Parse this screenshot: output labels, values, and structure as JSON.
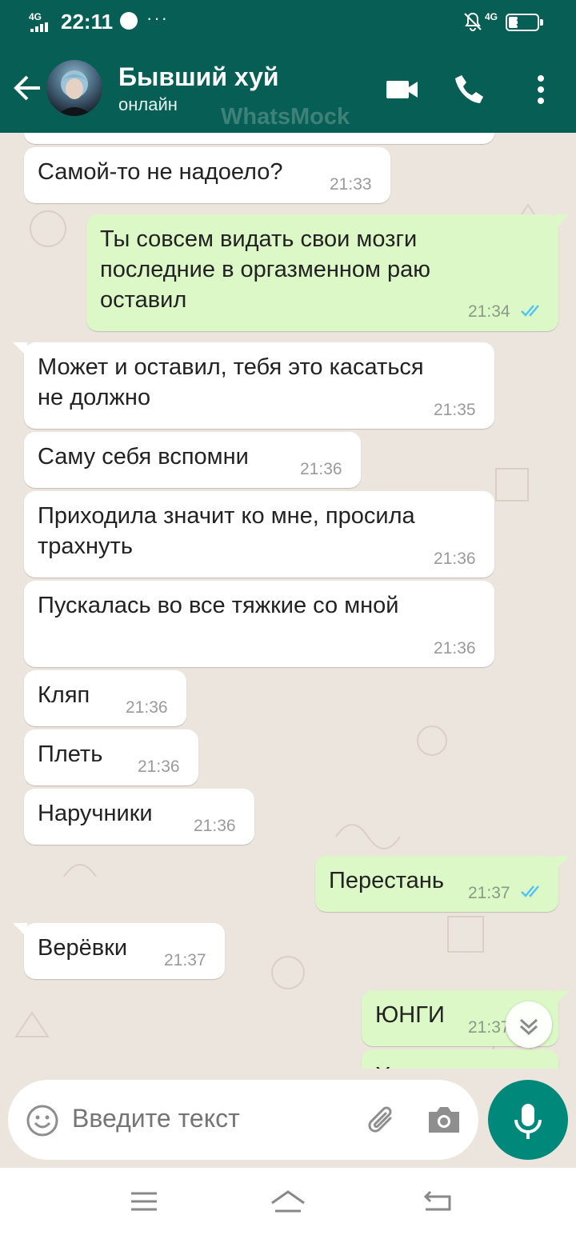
{
  "status_bar": {
    "network_left": "4G",
    "time": "22:11",
    "more": "···",
    "network_right": "4G",
    "battery_percent": 31,
    "battery_text": "31"
  },
  "header": {
    "contact_name": "Бывший хуй",
    "contact_status": "онлайн",
    "watermark": "WhatsMock",
    "icons": [
      "back-arrow-icon",
      "video-call-icon",
      "voice-call-icon",
      "more-vertical-icon"
    ]
  },
  "messages": [
    {
      "direction": "in",
      "text": "Самой-то не надоело?",
      "time": "21:33"
    },
    {
      "direction": "out",
      "text": "Ты совсем видать свои мозги\nпоследние в оргазменном раю\nоставил",
      "time": "21:34",
      "read": true
    },
    {
      "direction": "in",
      "text": "Может и оставил, тебя это касаться\nне должно",
      "time": "21:35"
    },
    {
      "direction": "in",
      "text": "Саму себя вспомни",
      "time": "21:36"
    },
    {
      "direction": "in",
      "text": "Приходила значит ко мне, просила\nтрахнуть",
      "time": "21:36"
    },
    {
      "direction": "in",
      "text": "Пускалась во все тяжкие со мной",
      "time": "21:36"
    },
    {
      "direction": "in",
      "text": "Кляп",
      "time": "21:36"
    },
    {
      "direction": "in",
      "text": "Плеть",
      "time": "21:36"
    },
    {
      "direction": "in",
      "text": "Наручники",
      "time": "21:36"
    },
    {
      "direction": "out",
      "text": "Перестань",
      "time": "21:37",
      "read": true
    },
    {
      "direction": "in",
      "text": "Верёвки",
      "time": "21:37"
    },
    {
      "direction": "out",
      "text": "ЮНГИ",
      "time": "21:37",
      "read": true
    },
    {
      "direction": "out",
      "text": "Хватит",
      "time": ""
    }
  ],
  "input": {
    "placeholder": "Введите текст"
  },
  "colors": {
    "header": "#075e54",
    "chat_background": "#ece5dd",
    "incoming_bubble": "#ffffff",
    "outgoing_bubble": "#dcf8c6",
    "read_ticks": "#4fc3f7",
    "mic_button": "#00897b"
  }
}
